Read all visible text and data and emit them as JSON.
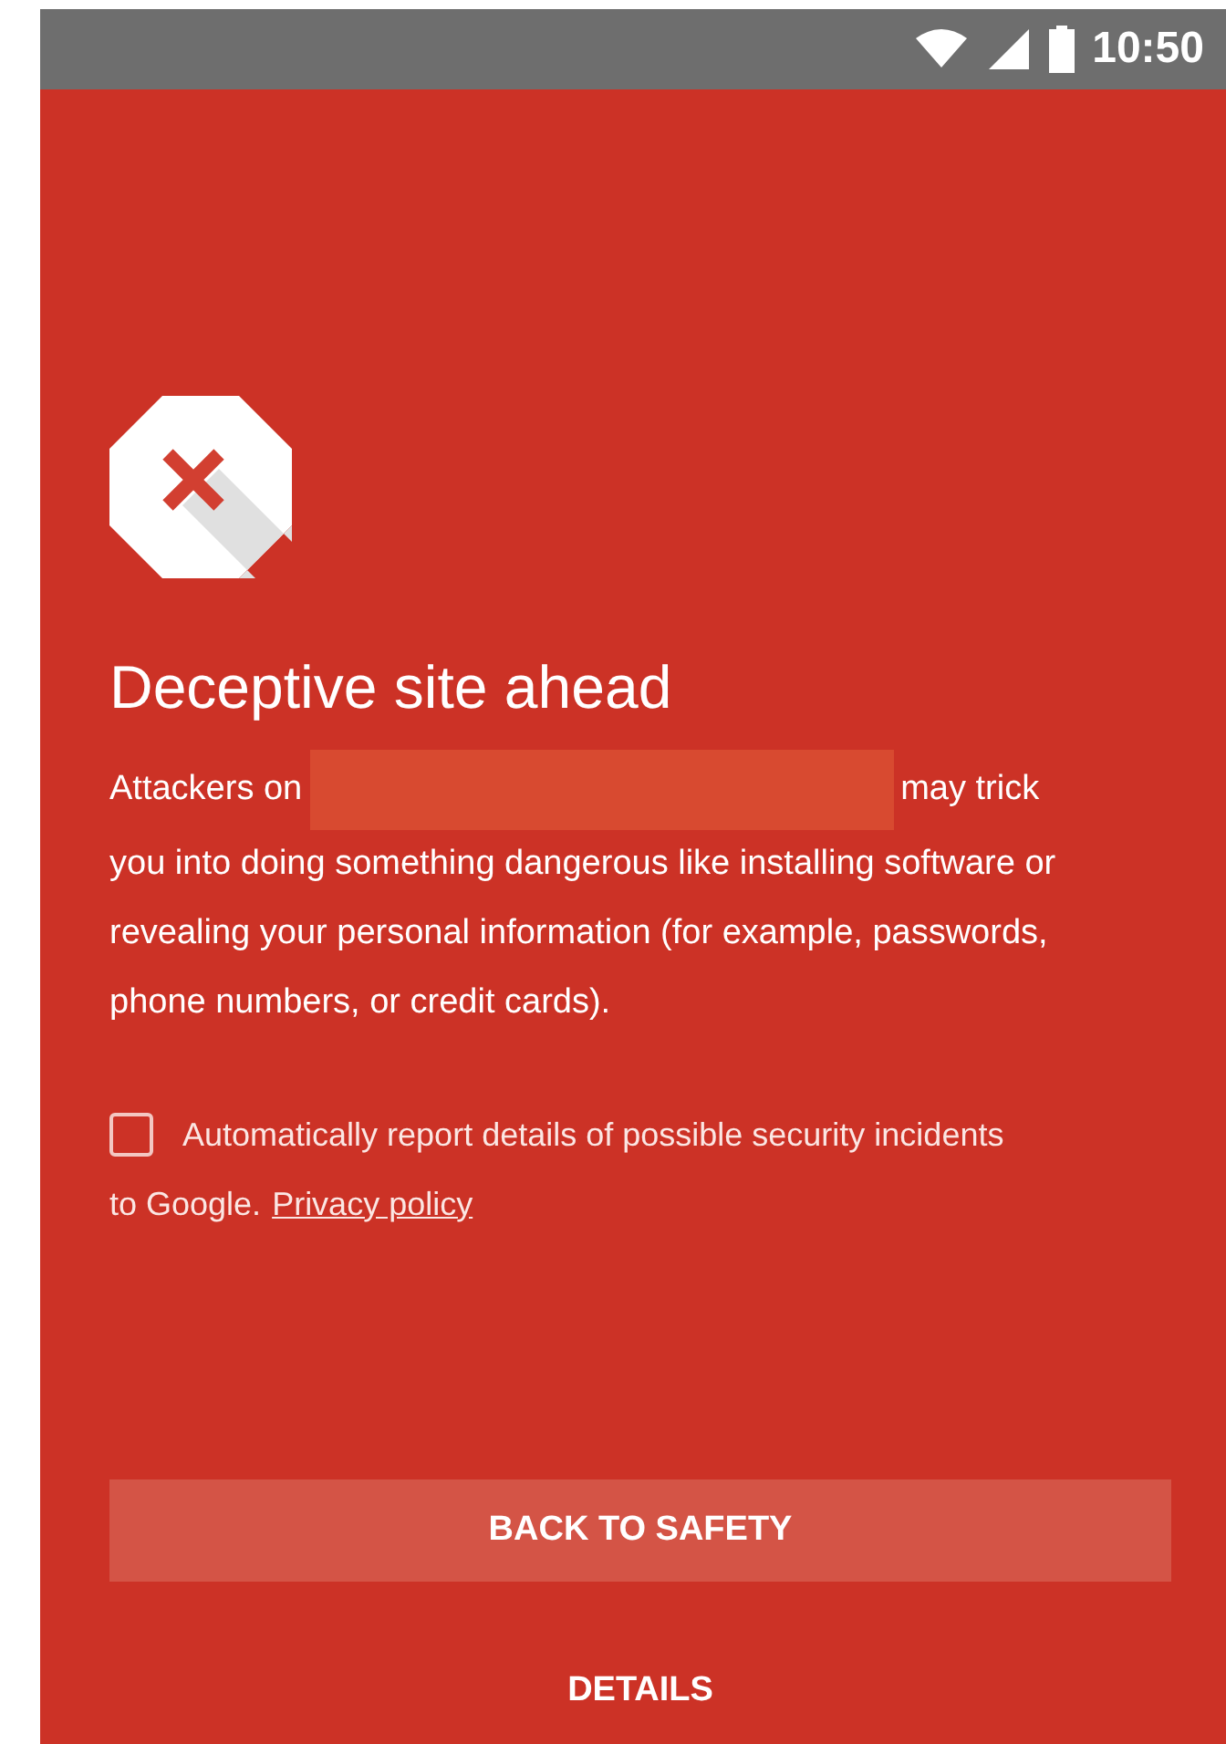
{
  "status_bar": {
    "time": "10:50"
  },
  "title": "Deceptive site ahead",
  "body": {
    "before": "Attackers on",
    "after": "may trick",
    "rest": "you into doing something dangerous like installing software or revealing your personal information (for example, passwords, phone numbers, or credit cards)."
  },
  "report": {
    "checked": false,
    "text": "Automatically report details of possible security incidents",
    "text_2": "to Google.",
    "link": "Privacy policy"
  },
  "buttons": {
    "primary": "BACK TO SAFETY",
    "secondary": "DETAILS"
  }
}
